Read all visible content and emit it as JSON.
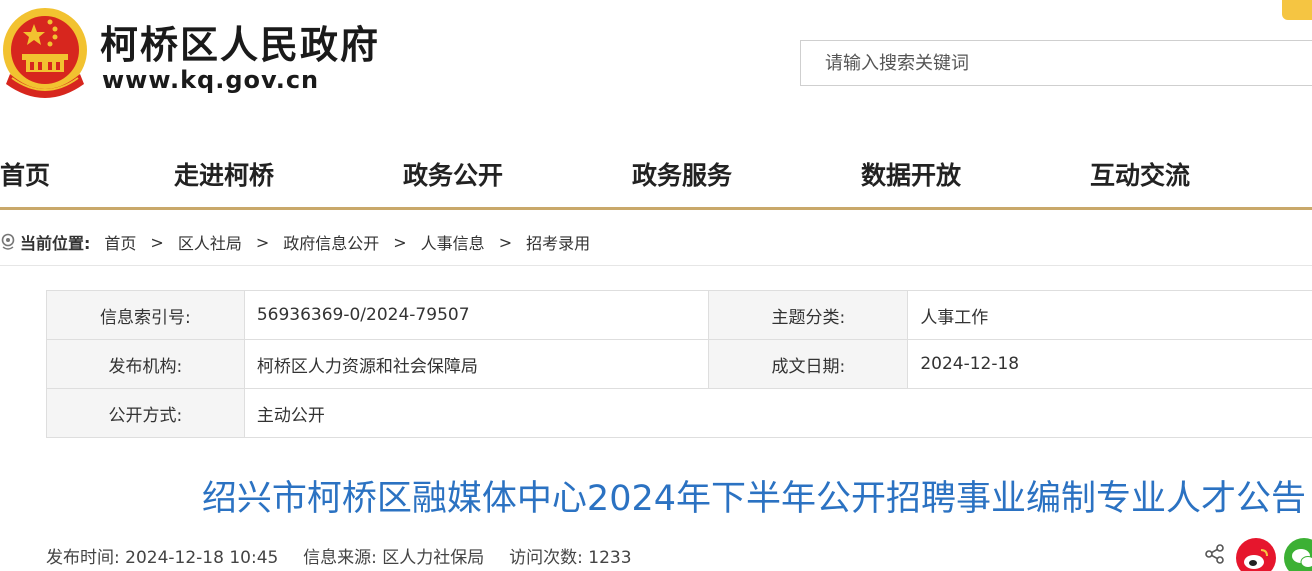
{
  "header": {
    "site_name": "柯桥区人民政府",
    "site_url": "www.kq.gov.cn",
    "search_placeholder": "请输入搜索关键词"
  },
  "nav": {
    "items": [
      "首页",
      "走进柯桥",
      "政务公开",
      "政务服务",
      "数据开放",
      "互动交流"
    ]
  },
  "breadcrumb": {
    "label": "当前位置:",
    "items": [
      "首页",
      "区人社局",
      "政府信息公开",
      "人事信息",
      "招考录用"
    ],
    "separator": ">"
  },
  "info": {
    "index_label": "信息索引号:",
    "index_value": "56936369-0/2024-79507",
    "topic_label": "主题分类:",
    "topic_value": "人事工作",
    "org_label": "发布机构:",
    "org_value": "柯桥区人力资源和社会保障局",
    "date_label": "成文日期:",
    "date_value": "2024-12-18",
    "mode_label": "公开方式:",
    "mode_value": "主动公开"
  },
  "article": {
    "title": "绍兴市柯桥区融媒体中心2024年下半年公开招聘事业编制专业人才公告",
    "publish_time_label": "发布时间:",
    "publish_time": "2024-12-18 10:45",
    "source_label": "信息来源:",
    "source": "区人力社保局",
    "visits_label": "访问次数:",
    "visits": "1233"
  },
  "colors": {
    "title_blue": "#2b72c2",
    "nav_underline": "#c9a86a",
    "emblem_red": "#d7261e",
    "emblem_gold": "#f2c230",
    "weibo_red": "#e6162d",
    "wechat_green": "#3cb034"
  },
  "icons": [
    "national-emblem",
    "location-pin-icon",
    "share-icon",
    "weibo-icon",
    "wechat-icon"
  ]
}
